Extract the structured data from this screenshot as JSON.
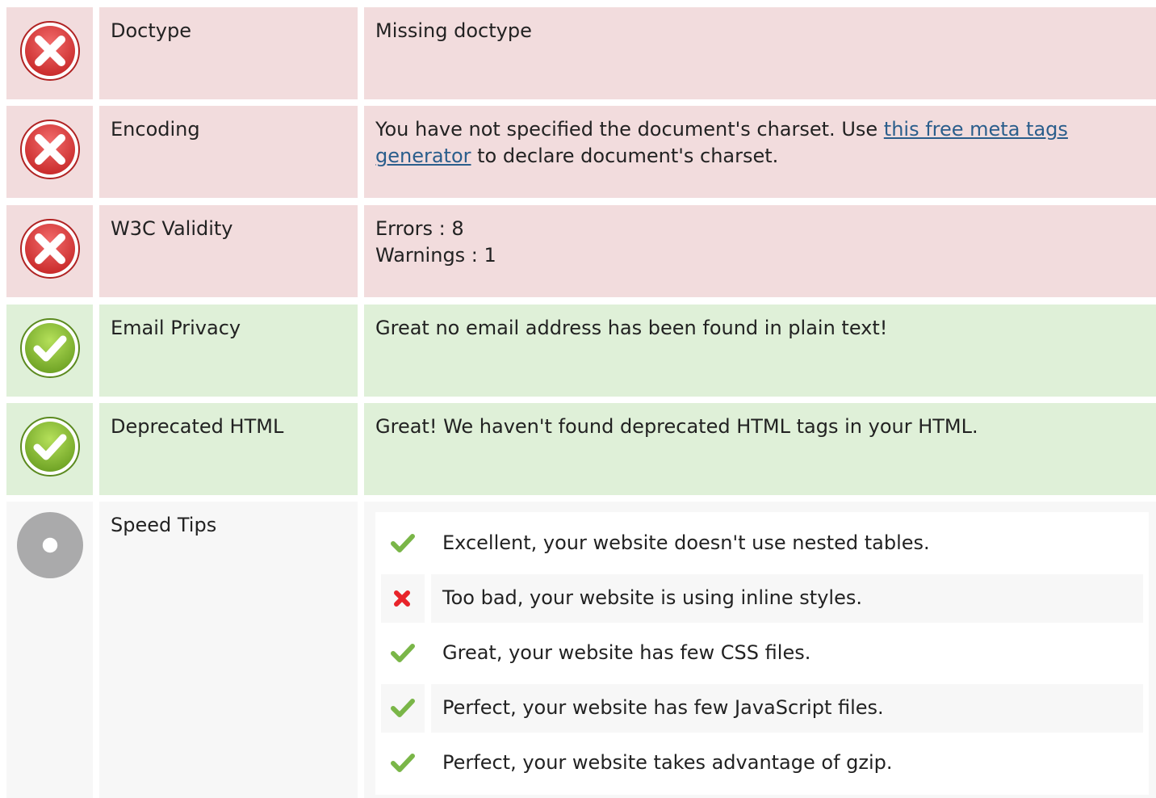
{
  "colors": {
    "error_bg": "#f2dcdd",
    "ok_bg": "#dff0d8",
    "neutral_bg": "#f7f7f7",
    "link": "#2b5e8c",
    "error_icon": "#e04040",
    "ok_icon": "#8dc63f",
    "neutral_icon": "#aaaaaa"
  },
  "rows": {
    "doctype": {
      "icon": "error-icon",
      "label": "Doctype",
      "value": "Missing doctype"
    },
    "encoding": {
      "icon": "error-icon",
      "label": "Encoding",
      "value_prefix": "You have not specified the document's charset. Use ",
      "link_text": "this free meta tags generator",
      "value_suffix": " to declare document's charset."
    },
    "w3c": {
      "icon": "error-icon",
      "label": "W3C Validity",
      "errors": "Errors : 8",
      "warnings": "Warnings : 1"
    },
    "email": {
      "icon": "ok-icon",
      "label": "Email Privacy",
      "value": "Great no email address has been found in plain text!"
    },
    "deprecated": {
      "icon": "ok-icon",
      "label": "Deprecated HTML",
      "value": "Great! We haven't found deprecated HTML tags in your HTML."
    },
    "speed": {
      "icon": "neutral-icon",
      "label": "Speed Tips",
      "tips": [
        {
          "status": "check-icon",
          "text": "Excellent, your website doesn't use nested tables."
        },
        {
          "status": "cross-icon",
          "text": "Too bad, your website is using inline styles."
        },
        {
          "status": "check-icon",
          "text": "Great, your website has few CSS files."
        },
        {
          "status": "check-icon",
          "text": "Perfect, your website has few JavaScript files."
        },
        {
          "status": "check-icon",
          "text": "Perfect, your website takes advantage of gzip."
        }
      ]
    }
  }
}
